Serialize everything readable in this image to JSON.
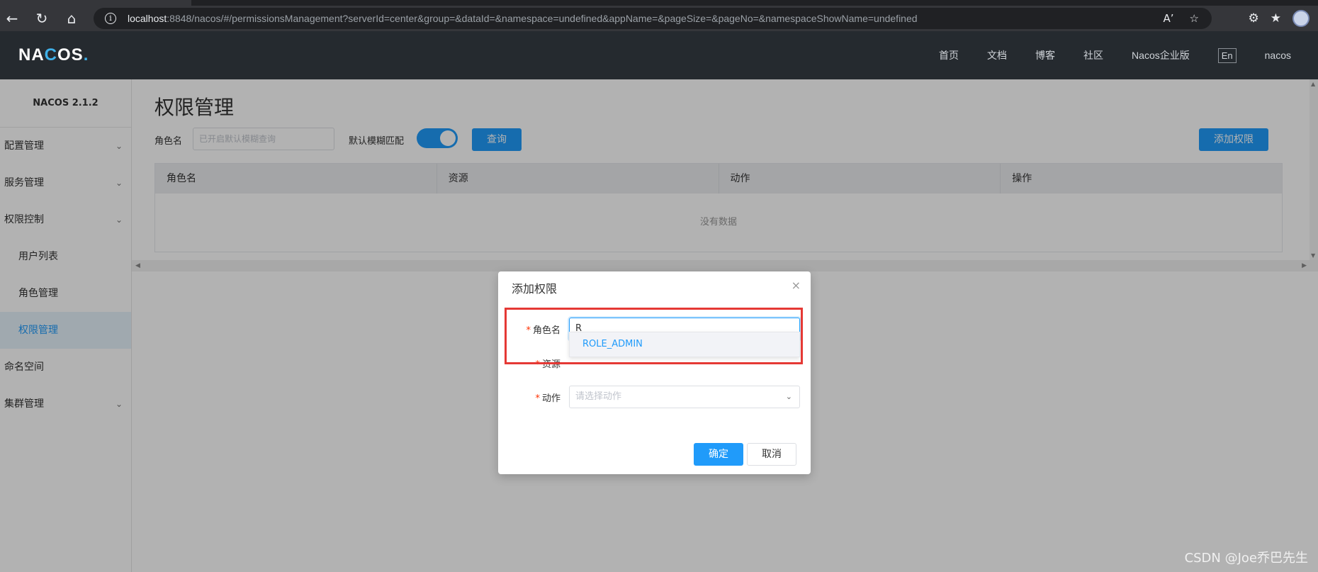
{
  "browser": {
    "nav_icons": [
      "back-icon",
      "reload-icon",
      "home-icon"
    ],
    "url_host": "localhost",
    "url_rest": ":8848/nacos/#/permissionsManagement?serverId=center&group=&dataId=&namespace=undefined&appName=&pageSize=&pageNo=&namespaceShowName=undefined",
    "read_aloud": "A’",
    "favorite": "☆",
    "extensions": "⚙",
    "favorites_bar": "★"
  },
  "header": {
    "logo_a": "NA",
    "logo_b": "C",
    "logo_c": "OS",
    "logo_dot": ".",
    "nav": [
      "首页",
      "文档",
      "博客",
      "社区",
      "Nacos企业版"
    ],
    "lang": "En",
    "user": "nacos"
  },
  "sidebar": {
    "version": "NACOS 2.1.2",
    "items": [
      {
        "label": "配置管理"
      },
      {
        "label": "服务管理"
      },
      {
        "label": "权限控制"
      },
      {
        "label": "用户列表"
      },
      {
        "label": "角色管理"
      },
      {
        "label": "权限管理"
      },
      {
        "label": "命名空间"
      },
      {
        "label": "集群管理"
      }
    ]
  },
  "main": {
    "title": "权限管理",
    "filter": {
      "role_label": "角色名",
      "role_placeholder": "已开启默认模糊查询",
      "fuzzy_label": "默认模糊匹配",
      "fuzzy_on": true,
      "query_button": "查询",
      "add_button": "添加权限"
    },
    "table": {
      "columns": [
        "角色名",
        "资源",
        "动作",
        "操作"
      ],
      "empty_text": "没有数据"
    }
  },
  "dialog": {
    "title": "添加权限",
    "close": "×",
    "required_mark": "*",
    "role_label": "角色名",
    "role_value": "R",
    "suggestion": "ROLE_ADMIN",
    "resource_label": "资源",
    "action_label": "动作",
    "action_placeholder": "请选择动作",
    "ok_button": "确定",
    "cancel_button": "取消"
  },
  "watermark": "CSDN @Joe乔巴先生",
  "colors": {
    "primary": "#209bfa",
    "header_bg": "#252a2f",
    "highlight": "#e53935"
  }
}
